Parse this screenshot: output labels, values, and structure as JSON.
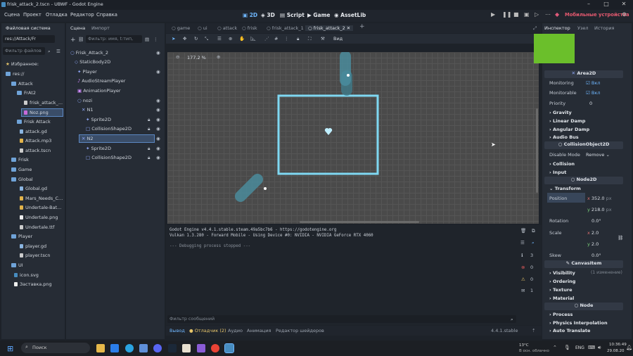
{
  "window": {
    "title": "frisk_attack_2.tscn - UBWF - Godot Engine"
  },
  "menu": {
    "items": [
      "Сцена",
      "Проект",
      "Отладка",
      "Редактор",
      "Справка"
    ]
  },
  "workspaces": {
    "w2d": "2D",
    "w3d": "3D",
    "script": "Script",
    "game": "Game",
    "assetlib": "AssetLib"
  },
  "renderer": "Мобильные устройства",
  "filesystem": {
    "tab": "Файловая система",
    "path": "res://Attack/Fr",
    "filter": "Фильтр файлов",
    "items": [
      "Избранное:",
      "res://",
      "Attack",
      "FrAt2",
      "frisk_attack_...",
      "Noz.png",
      "Frisk Attack",
      "attack.gd",
      "Attack.mp3",
      "attack.tscn",
      "Frisk",
      "Game",
      "Global",
      "Global.gd",
      "Mars_Needs_C...",
      "Undertale-Bat...",
      "Undertale.png",
      "Undertale.ttf",
      "Player",
      "player.gd",
      "player.tscn",
      "UI",
      "icon.svg",
      "Заставка.png"
    ]
  },
  "scene": {
    "tab1": "Сцена",
    "tab2": "Импорт",
    "filter": "Фильтр: имя, t:тип,",
    "nodes": [
      "Frisk_Attack_2",
      "StaticBody2D",
      "Player",
      "AudioStreamPlayer",
      "AnimationPlayer",
      "nozi",
      "N1",
      "Sprite2D",
      "CollisionShape2D",
      "N2",
      "Sprite2D",
      "CollisionShape2D"
    ]
  },
  "doc_tabs": [
    "game",
    "ui",
    "attack",
    "frisk",
    "frisk_attack_1",
    "frisk_attack_2"
  ],
  "viewport": {
    "zoom": "177.2 %",
    "view": "Вид"
  },
  "output": {
    "lines": [
      "Godot Engine v4.4.1.stable.steam.49a5bc7b6 - https://godotengine.org",
      "Vulkan 1.3.280 - Forward Mobile - Using Device #0: NVIDIA - NVIDIA GeForce RTX 4060",
      "--- Debugging process stopped ---"
    ],
    "filter": "Фильтр сообщений",
    "counts": [
      "3",
      "0",
      "0",
      "1"
    ]
  },
  "bottom_tabs": [
    "Вывод",
    "Отладчик (2)",
    "Аудио",
    "Анимация",
    "Редактор шейдеров"
  ],
  "version": "4.4.1.stable",
  "inspector": {
    "tab1": "Инспектор",
    "tab2": "Узел",
    "tab3": "История",
    "area": "Area2D",
    "monitoring": "Monitoring",
    "monitorable": "Monitorable",
    "on": "Вкл",
    "priority": "Priority",
    "priority_val": "0",
    "cats1": [
      "Gravity",
      "Linear Damp",
      "Angular Damp",
      "Audio Bus"
    ],
    "collision_obj": "CollisionObject2D",
    "disable_mode": "Disable Mode",
    "disable_val": "Remove",
    "collision": "Collision",
    "input": "Input",
    "node2d": "Node2D",
    "transform": "Transform",
    "position": "Position",
    "pos_x": "352.0",
    "pos_y": "218.0",
    "px": "px",
    "rotation": "Rotation",
    "rotation_val": "0.0",
    "deg": "°",
    "scale": "Scale",
    "scale_x": "2.0",
    "scale_y": "2.0",
    "skew": "Skew",
    "skew_val": "0.0",
    "canvas": "CanvasItem",
    "visibility": "Visibility",
    "changes": "(1 изменение)",
    "ordering": "Ordering",
    "texture": "Texture",
    "material": "Material",
    "node": "Node",
    "process": "Process",
    "physics": "Physics Interpolation",
    "autotr": "Auto Translate"
  },
  "taskbar": {
    "search": "Поиск",
    "temp": "13°C",
    "weather": "В осн. облачно",
    "lang": "ENG",
    "time": "10:36:49",
    "date": "29.08.20"
  },
  "colors": {
    "accent": "#6fb7ff",
    "shape": "#66c8e8"
  }
}
